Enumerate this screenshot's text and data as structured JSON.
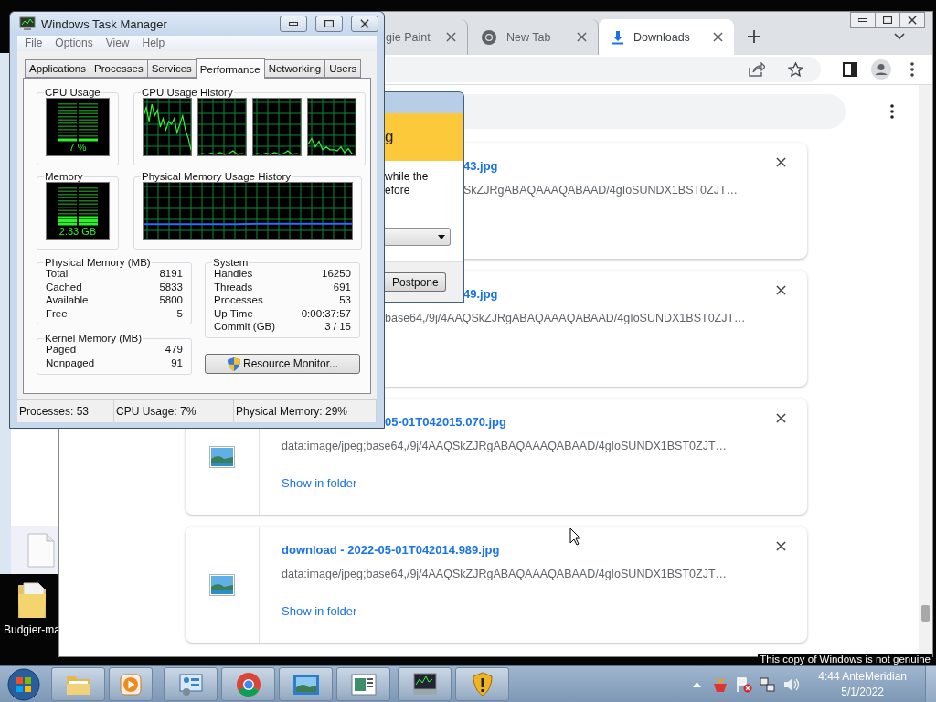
{
  "task_manager": {
    "title": "Windows Task Manager",
    "menu": [
      "File",
      "Options",
      "View",
      "Help"
    ],
    "tabs": [
      {
        "label": "Applications",
        "selected": false
      },
      {
        "label": "Processes",
        "selected": false
      },
      {
        "label": "Services",
        "selected": false
      },
      {
        "label": "Performance",
        "selected": true
      },
      {
        "label": "Networking",
        "selected": false
      },
      {
        "label": "Users",
        "selected": false
      }
    ],
    "cpu_usage": {
      "label": "CPU Usage",
      "reading": "7 %",
      "level": 0.07
    },
    "cpu_history": {
      "label": "CPU Usage History"
    },
    "memory": {
      "label": "Memory",
      "reading": "2.33 GB",
      "level": 0.29
    },
    "memory_history": {
      "label": "Physical Memory Usage History"
    },
    "physical_memory": {
      "label": "Physical Memory (MB)",
      "rows": [
        {
          "label": "Total",
          "value": "8191"
        },
        {
          "label": "Cached",
          "value": "5833"
        },
        {
          "label": "Available",
          "value": "5800"
        },
        {
          "label": "Free",
          "value": "5"
        }
      ]
    },
    "kernel_memory": {
      "label": "Kernel Memory (MB)",
      "rows": [
        {
          "label": "Paged",
          "value": "479"
        },
        {
          "label": "Nonpaged",
          "value": "91"
        }
      ]
    },
    "system": {
      "label": "System",
      "rows": [
        {
          "label": "Handles",
          "value": "16250"
        },
        {
          "label": "Threads",
          "value": "691"
        },
        {
          "label": "Processes",
          "value": "53"
        },
        {
          "label": "Up Time",
          "value": "0:00:37:57"
        },
        {
          "label": "Commit (GB)",
          "value": "3 / 15"
        }
      ]
    },
    "resource_monitor_button": "Resource Monitor...",
    "status_bar": [
      "Processes: 53",
      "CPU Usage: 7%",
      "Physical Memory: 29%"
    ]
  },
  "update_dialog": {
    "title": "g",
    "message_lines": [
      "while the",
      "efore"
    ],
    "postpone_button": "Postpone"
  },
  "browser": {
    "tabs": [
      {
        "label": "gie Paint",
        "selected": false,
        "kind": "plain"
      },
      {
        "label": "New Tab",
        "selected": false,
        "kind": "newtab"
      },
      {
        "label": "Downloads",
        "selected": true,
        "kind": "downloads"
      }
    ],
    "downloads": [
      {
        "filename": "43.jpg",
        "url": "SkZJRgABAQAAAQABAAD/4gIoSUNDX1BST0ZJT…"
      },
      {
        "filename": "49.jpg",
        "url": "base64,/9j/4AAQSkZJRgABAQAAAQABAAD/4gIoSUNDX1BST0ZJT…"
      },
      {
        "filename": "05-01T042015.070.jpg",
        "url": "data:image/jpeg;base64,/9j/4AAQSkZJRgABAQAAAQABAAD/4gIoSUNDX1BST0ZJT…",
        "link": "Show in folder"
      },
      {
        "filename": "download - 2022-05-01T042014.989.jpg",
        "url": "data:image/jpeg;base64,/9j/4AAQSkZJRgABAQAAAQABAAD/4gIoSUNDX1BST0ZJT…",
        "link": "Show in folder"
      }
    ]
  },
  "desktop_icons": [
    {
      "label": "Budgier-ma"
    }
  ],
  "genuine_notice": "This copy of Windows is not genuine",
  "taskbar": {
    "time": "4:44 AnteMeridian",
    "date": "5/1/2022"
  }
}
